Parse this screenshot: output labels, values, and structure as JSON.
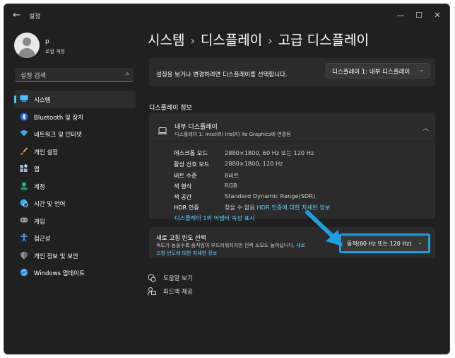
{
  "window": {
    "title": "설정",
    "back_icon": "arrow-left-icon",
    "controls": [
      "minimize-icon",
      "maximize-icon",
      "close-icon"
    ]
  },
  "user": {
    "name": "p",
    "account_type": "로컬 계정"
  },
  "search": {
    "placeholder": "설정 검색"
  },
  "sidebar": {
    "items": [
      {
        "label": "시스템",
        "icon": "monitor-icon",
        "active": true,
        "color": "#4cc2ff"
      },
      {
        "label": "Bluetooth 및 장치",
        "icon": "bluetooth-icon",
        "color": "#3b82f6"
      },
      {
        "label": "네트워크 및 인터넷",
        "icon": "wifi-icon",
        "color": "#3ea7e8"
      },
      {
        "label": "개인 설정",
        "icon": "brush-icon",
        "color": "#e3a35a"
      },
      {
        "label": "앱",
        "icon": "apps-icon",
        "color": "#9fb6cf"
      },
      {
        "label": "계정",
        "icon": "person-icon",
        "color": "#2fb58c"
      },
      {
        "label": "시간 및 언어",
        "icon": "globe-clock-icon",
        "color": "#3ea7e8"
      },
      {
        "label": "게임",
        "icon": "gamepad-icon",
        "color": "#9a9a9a"
      },
      {
        "label": "접근성",
        "icon": "accessibility-icon",
        "color": "#48a8ff"
      },
      {
        "label": "개인 정보 및 보안",
        "icon": "shield-icon",
        "color": "#a0a0a0"
      },
      {
        "label": "Windows 업데이트",
        "icon": "update-icon",
        "color": "#3ea7e8"
      }
    ]
  },
  "breadcrumb": {
    "items": [
      "시스템",
      "디스플레이",
      "고급 디스플레이"
    ],
    "separator": "›"
  },
  "select_display": {
    "text": "설정을 보거나 변경하려면 디스플레이를 선택합니다.",
    "value": "디스플레이 1: 내부 디스플레이"
  },
  "display_info": {
    "section_title": "디스플레이 정보",
    "name": "내부 디스플레이",
    "subtitle": "디스플레이 1: Intel(R) Iris(R) Xe Graphics에 연결됨",
    "rows": [
      {
        "key": "데스크톱 모드",
        "value": "2880×1800, 60 Hz 또는 120 Hz"
      },
      {
        "key": "활성 신호 모드",
        "value": "2880×1800, 120 Hz"
      },
      {
        "key": "비트 수준",
        "value": "8비트"
      },
      {
        "key": "색 형식",
        "value": "RGB"
      },
      {
        "key": "색 공간",
        "value": "Standard Dynamic Range(SDR)"
      },
      {
        "key": "HDR 인증",
        "value": "찾을 수 없음",
        "link": "HDR 인증에 대한 자세한 정보"
      }
    ],
    "adapter_link": "디스플레이 1의 어댑터 속성 표시"
  },
  "refresh_rate": {
    "title": "새로 고침 빈도 선택",
    "description": "속도가 높을수록 움직임이 부드러워지지만 전력 소모도 늘어납니다.",
    "link_part1": "새로",
    "link_part2": "고침 빈도에 대한 자세한 정보",
    "value": "동적(60 Hz 또는 120 Hz)",
    "highlight_color": "#1ea0dc"
  },
  "footer_links": [
    {
      "label": "도움말 보기",
      "icon": "help-icon"
    },
    {
      "label": "피드백 제공",
      "icon": "feedback-icon"
    }
  ]
}
